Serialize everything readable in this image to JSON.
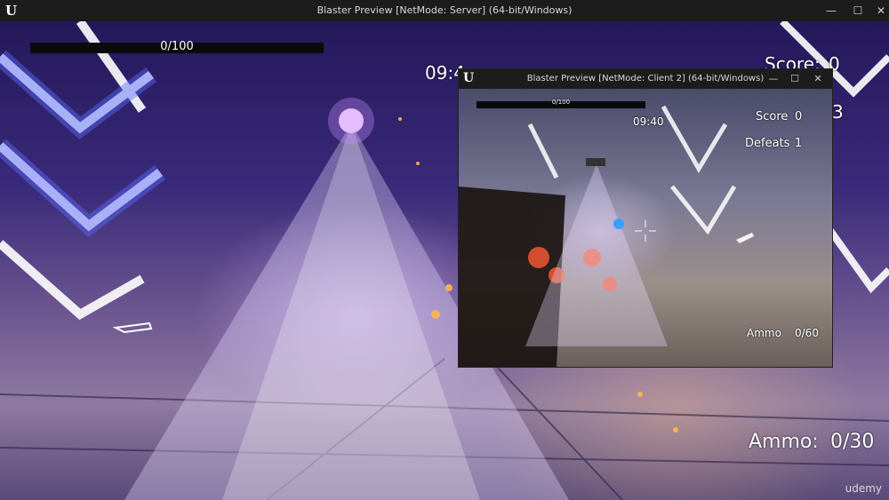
{
  "server_window": {
    "title": "Blaster Preview [NetMode: Server]  (64-bit/Windows)",
    "logo": "U",
    "controls": {
      "minimize": "—",
      "maximize": "☐",
      "close": "✕"
    }
  },
  "server_hud": {
    "health_text": "0/100",
    "timer": "09:4",
    "score_label": "Score:",
    "score_value": "0",
    "partial_digit": "3",
    "ammo_label": "Ammo:",
    "ammo_value": "0/30"
  },
  "client_window": {
    "title": "Blaster Preview [NetMode: Client 2]  (64-bit/Windows)",
    "logo": "U",
    "controls": {
      "minimize": "—",
      "maximize": "☐",
      "close": "✕"
    }
  },
  "client_hud": {
    "health_text": "0/100",
    "timer": "09:40",
    "score_label": "Score",
    "score_value": "0",
    "defeats_label": "Defeats",
    "defeats_value": "1",
    "ammo_label": "Ammo",
    "ammo_value": "0/60"
  },
  "watermark": "udemy",
  "icons": {
    "crosshair": "crosshair-icon",
    "weapon_pickup": "rifle-pickup-icon"
  }
}
